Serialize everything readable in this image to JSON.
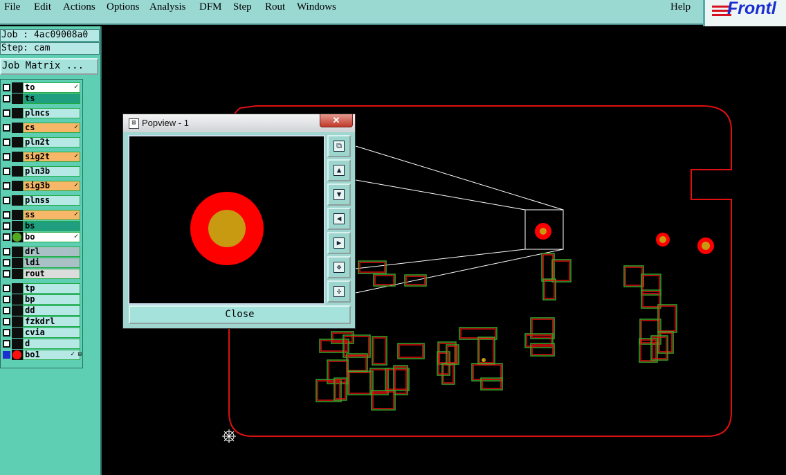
{
  "menubar": {
    "items": [
      "File",
      "Edit",
      "Actions",
      "Options",
      "Analysis",
      "DFM",
      "Step",
      "Rout",
      "Windows"
    ],
    "help": "Help",
    "logo": "Frontl"
  },
  "job": {
    "job_label": "Job : 4ac09008a0",
    "step_label": "Step: cam",
    "matrix_button": "Job Matrix ..."
  },
  "layers": [
    {
      "name": "to",
      "color": "#ffffff",
      "mark": "✓"
    },
    {
      "name": "ts",
      "color": "#1f9f80",
      "mark": ""
    },
    {
      "name": "plncs",
      "color": "#b6e9e6",
      "mark": ""
    },
    {
      "name": "cs",
      "color": "#f7b768",
      "mark": "✓"
    },
    {
      "name": "pln2t",
      "color": "#b6e9e6",
      "mark": ""
    },
    {
      "name": "sig2t",
      "color": "#f7b768",
      "mark": "✓"
    },
    {
      "name": "pln3b",
      "color": "#b6e9e6",
      "mark": ""
    },
    {
      "name": "sig3b",
      "color": "#f7b768",
      "mark": "✓"
    },
    {
      "name": "plnss",
      "color": "#b6e9e6",
      "mark": ""
    },
    {
      "name": "ss",
      "color": "#f7b768",
      "mark": "✓"
    },
    {
      "name": "bs",
      "color": "#1f9f80",
      "mark": ""
    },
    {
      "name": "bo",
      "color": "#ffffff",
      "mark": "✓",
      "dot": "#55a822"
    },
    {
      "name": "drl",
      "color": "#a9c1c6",
      "mark": ""
    },
    {
      "name": "ldi",
      "color": "#a9c1c6",
      "mark": ""
    },
    {
      "name": "rout",
      "color": "#dcdcdc",
      "mark": ""
    },
    {
      "name": "tp",
      "color": "#b6e9e6",
      "mark": ""
    },
    {
      "name": "bp",
      "color": "#b6e9e6",
      "mark": ""
    },
    {
      "name": "dd",
      "color": "#b6e9e6",
      "mark": ""
    },
    {
      "name": "fzkdrl",
      "color": "#b6e9e6",
      "mark": ""
    },
    {
      "name": "cvia",
      "color": "#b6e9e6",
      "mark": ""
    },
    {
      "name": "d",
      "color": "#b6e9e6",
      "mark": ""
    },
    {
      "name": "bo1",
      "color": "#b6e9e6",
      "mark": "✓",
      "mark2": "⊞",
      "dot": "#ff1010",
      "selected": true
    }
  ],
  "popview": {
    "title": "Popview - 1",
    "close_x": "✕",
    "close_button": "Close",
    "buttons": [
      "fit-view",
      "pan-up",
      "pan-down",
      "pan-left",
      "pan-right",
      "zoom-in",
      "zoom-out"
    ]
  },
  "colors": {
    "board_outline": "#e01010",
    "pad_outer": "#ff0000",
    "pad_inner": "#c89a12",
    "comp_green": "#3aa52a"
  }
}
